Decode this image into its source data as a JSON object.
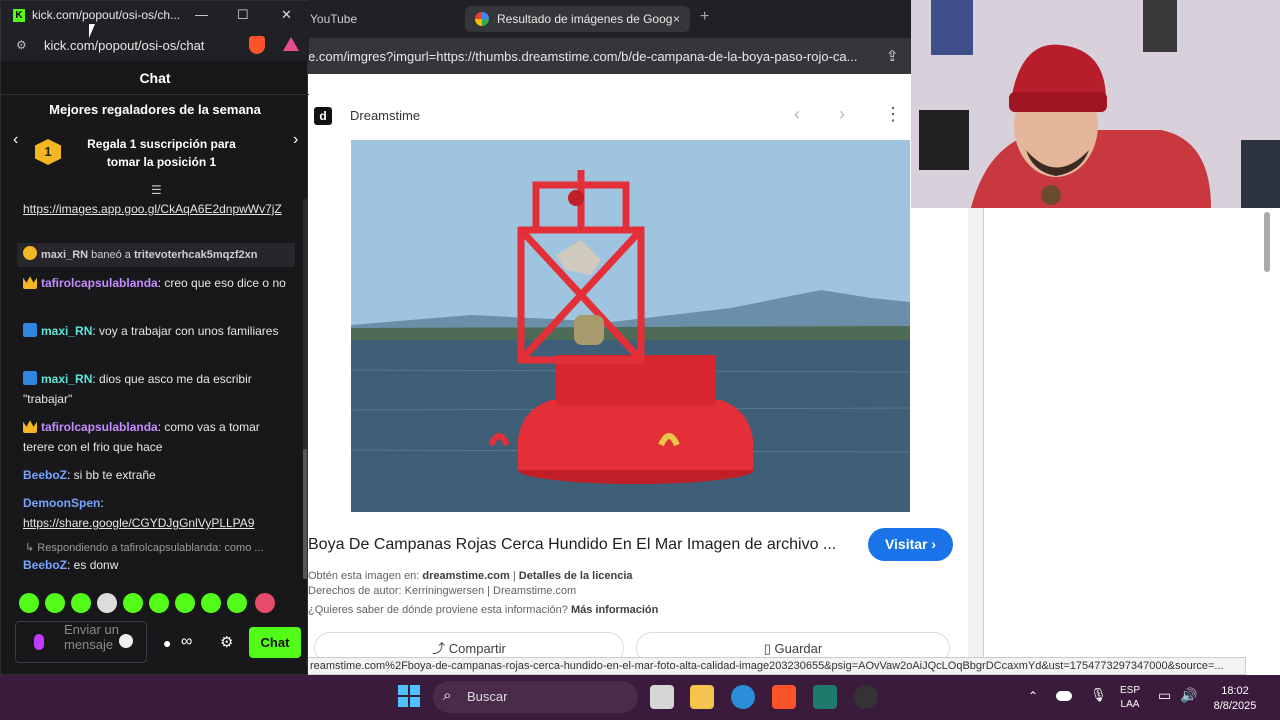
{
  "browser": {
    "tabs": [
      "YouTube",
      "Resultado de imágenes de Goog"
    ],
    "tab_close": "×",
    "new_tab": "+",
    "url": "e.com/imgres?imgurl=https://thumbs.dreamstime.com/b/de-campana-de-la-boya-paso-rojo-ca...",
    "status_url": "reamstime.com%2Fboya-de-campanas-rojas-cerca-hundido-en-el-mar-foto-alta-calidad-image203230655&psig=AOvVaw2oAiJQcLOqBbgrDCcaxmYd&ust=1754773297347000&source=..."
  },
  "gimages": {
    "source_name": "Dreamstime",
    "source_logo": "d",
    "title": "Boya De Campanas Rojas Cerca Hundido En El Mar Imagen de archivo ...",
    "visit_label": "Visitar ›",
    "obtain_prefix": "Obtén esta imagen en: ",
    "obtain_source": "dreamstime.com",
    "obtain_sep": " | ",
    "license_link": "Detalles de la licencia",
    "copyright": "Derechos de autor: Kerriningwersen | Dreamstime.com",
    "where_q": "¿Quieres saber de dónde proviene esta información? ",
    "more_info": "Más información",
    "share_label": "Compartir",
    "save_label": "Guardar"
  },
  "kick": {
    "window_title": "kick.com/popout/osi-os/ch...",
    "address": "kick.com/popout/osi-os/chat",
    "chat_header": "Chat",
    "gifters_title": "Mejores regaladores de la semana",
    "gift_rank": "1",
    "gift_text": "Regala 1 suscripción para tomar la posición 1",
    "link1": "https://images.app.goo.gl/CkAqA6E2dnpwWv7jZ",
    "sys_user": "maxi_RN",
    "sys_action": " baneó a ",
    "sys_target": "tritevoterhcak5mqzf2xn",
    "messages": [
      {
        "user": "tafirolcapsulablanda",
        "text": ": creo que eso dice o no"
      },
      {
        "user": "maxi_RN",
        "text": ": voy a trabajar con unos familiares"
      },
      {
        "user": "maxi_RN",
        "text": ": dios que asco me da escribir \"trabajar\""
      },
      {
        "user": "tafirolcapsulablanda",
        "text": ": como vas a tomar terere con el frio que hace"
      },
      {
        "user": "BeeboZ",
        "text": ": si bb te extrañe"
      },
      {
        "user": "DemoonSpen",
        "text": ":"
      },
      {
        "user": "BeeboZ",
        "text": ": es donw"
      }
    ],
    "link2": "https://share.google/CGYDJgGnlVyPLLPA9",
    "reply_note": "↳ Respondiendo a tafirolcapsulablanda: como ...",
    "input_placeholder": "Enviar un mensaje",
    "chat_button": "Chat"
  },
  "taskbar": {
    "search": "Buscar",
    "lang_top": "ESP",
    "lang_bottom": "LAA",
    "time": "18:02",
    "date": "8/8/2025"
  },
  "colors": {
    "kick_green": "#53fc18",
    "google_blue": "#1a73e8",
    "taskbar": "#3b1b3b"
  }
}
